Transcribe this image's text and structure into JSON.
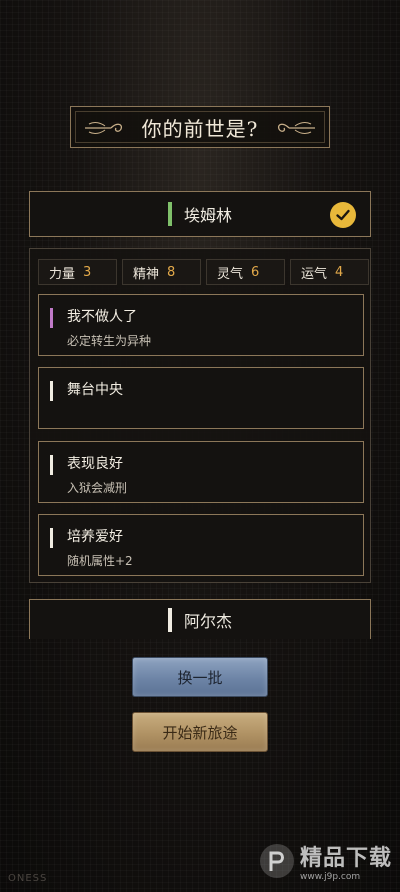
{
  "title": "你的前世是?",
  "selected_character": {
    "name": "埃姆林",
    "bar_color": "#7fc06a",
    "selected": true
  },
  "stats": [
    {
      "label": "力量",
      "value": "3"
    },
    {
      "label": "精神",
      "value": "8"
    },
    {
      "label": "灵气",
      "value": "6"
    },
    {
      "label": "运气",
      "value": "4"
    }
  ],
  "talents": [
    {
      "name": "我不做人了",
      "desc": "必定转生为异种",
      "bar_color": "#c07ac8"
    },
    {
      "name": "舞台中央",
      "desc": "",
      "bar_color": "#f0ece2"
    },
    {
      "name": "表现良好",
      "desc": "入狱会减刑",
      "bar_color": "#f0ece2"
    },
    {
      "name": "培养爱好",
      "desc": "随机属性+2",
      "bar_color": "#f0ece2"
    }
  ],
  "next_character": {
    "name": "阿尔杰"
  },
  "buttons": {
    "refresh": "换一批",
    "start": "开始新旅途"
  },
  "watermark": {
    "main": "精品下载",
    "sub": "www.j9p.com"
  },
  "corner_text": "ONESS",
  "colors": {
    "accent_gold": "#e8b83a",
    "stat_value": "#e2a94a",
    "frame": "#8c7759"
  }
}
